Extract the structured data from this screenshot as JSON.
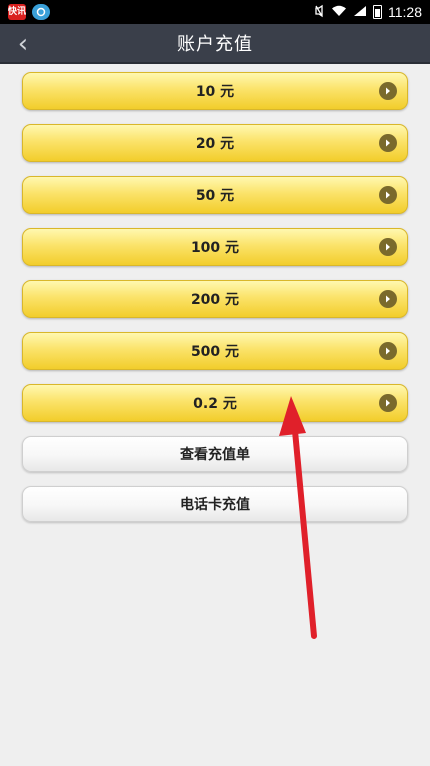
{
  "status_bar": {
    "app_icons": [
      {
        "name": "news-app-icon",
        "text": "快讯"
      },
      {
        "name": "browser-app-icon",
        "text": ""
      }
    ],
    "time": "11:28"
  },
  "header": {
    "title": "账户充值",
    "back_icon": "‹"
  },
  "recharge_options": [
    {
      "label": "10 元"
    },
    {
      "label": "20 元"
    },
    {
      "label": "50 元"
    },
    {
      "label": "100 元"
    },
    {
      "label": "200 元"
    },
    {
      "label": "500 元"
    },
    {
      "label": "0.2 元"
    }
  ],
  "actions": {
    "view_orders": "查看充值单",
    "phone_card": "电话卡充值"
  },
  "colors": {
    "header_bg": "#3a3f4a",
    "option_gold": "#fbe36a",
    "annotation_arrow": "#e0202a"
  }
}
